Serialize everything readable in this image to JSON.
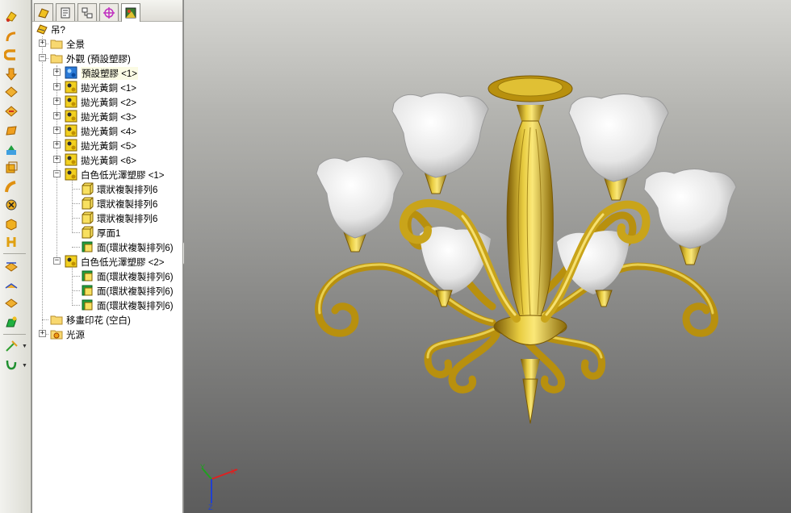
{
  "left_toolbar": {
    "buttons": [
      "appearance-icon",
      "extruded-boss-icon",
      "revolved-boss-icon",
      "extruded-cut-icon",
      "fillet-icon",
      "chamfer-icon",
      "rib-icon",
      "draft-icon",
      "shell-icon",
      "wrap-icon",
      "dome-icon",
      "mirror-icon",
      "reference-geometry-icon",
      "curves-icon",
      "linear-pattern-icon",
      "circular-pattern-icon",
      "appearance-edit-icon",
      "instant3d-icon"
    ]
  },
  "panel_tabs": [
    "feature-manager-tab",
    "property-manager-tab",
    "configuration-manager-tab",
    "dimxpert-manager-tab",
    "display-manager-tab"
  ],
  "tree": {
    "root": "吊?",
    "items": [
      {
        "label": "全景",
        "icon": "folder"
      },
      {
        "label": "外觀 (預設塑膠)",
        "icon": "folder"
      },
      {
        "label": "預設塑膠 <1>",
        "icon": "appearance-blue"
      },
      {
        "label": "拋光黃銅 <1>",
        "icon": "appearance-yellow"
      },
      {
        "label": "拋光黃銅 <2>",
        "icon": "appearance-yellow"
      },
      {
        "label": "拋光黃銅 <3>",
        "icon": "appearance-yellow"
      },
      {
        "label": "拋光黃銅 <4>",
        "icon": "appearance-yellow"
      },
      {
        "label": "拋光黃銅 <5>",
        "icon": "appearance-yellow"
      },
      {
        "label": "拋光黃銅 <6>",
        "icon": "appearance-yellow"
      },
      {
        "label": "白色低光澤塑膠 <1>",
        "icon": "appearance-yellow"
      },
      {
        "label": "環狀複製排列6",
        "icon": "body"
      },
      {
        "label": "環狀複製排列6",
        "icon": "body"
      },
      {
        "label": "環狀複製排列6",
        "icon": "body"
      },
      {
        "label": "厚面1",
        "icon": "body"
      },
      {
        "label": "面(環狀複製排列6)",
        "icon": "face"
      },
      {
        "label": "白色低光澤塑膠 <2>",
        "icon": "appearance-yellow"
      },
      {
        "label": "面(環狀複製排列6)",
        "icon": "face"
      },
      {
        "label": "面(環狀複製排列6)",
        "icon": "face"
      },
      {
        "label": "面(環狀複製排列6)",
        "icon": "face"
      },
      {
        "label": "移畫印花 (空白)",
        "icon": "folder"
      },
      {
        "label": "光源",
        "icon": "lights-folder"
      }
    ]
  },
  "colors": {
    "brass": "#c9a41a",
    "brass_dark": "#8a6b08",
    "brass_light": "#f0d858",
    "shade": "#f4f4f4"
  },
  "triad": {
    "x": "X",
    "y": "Y",
    "z": "Z"
  }
}
